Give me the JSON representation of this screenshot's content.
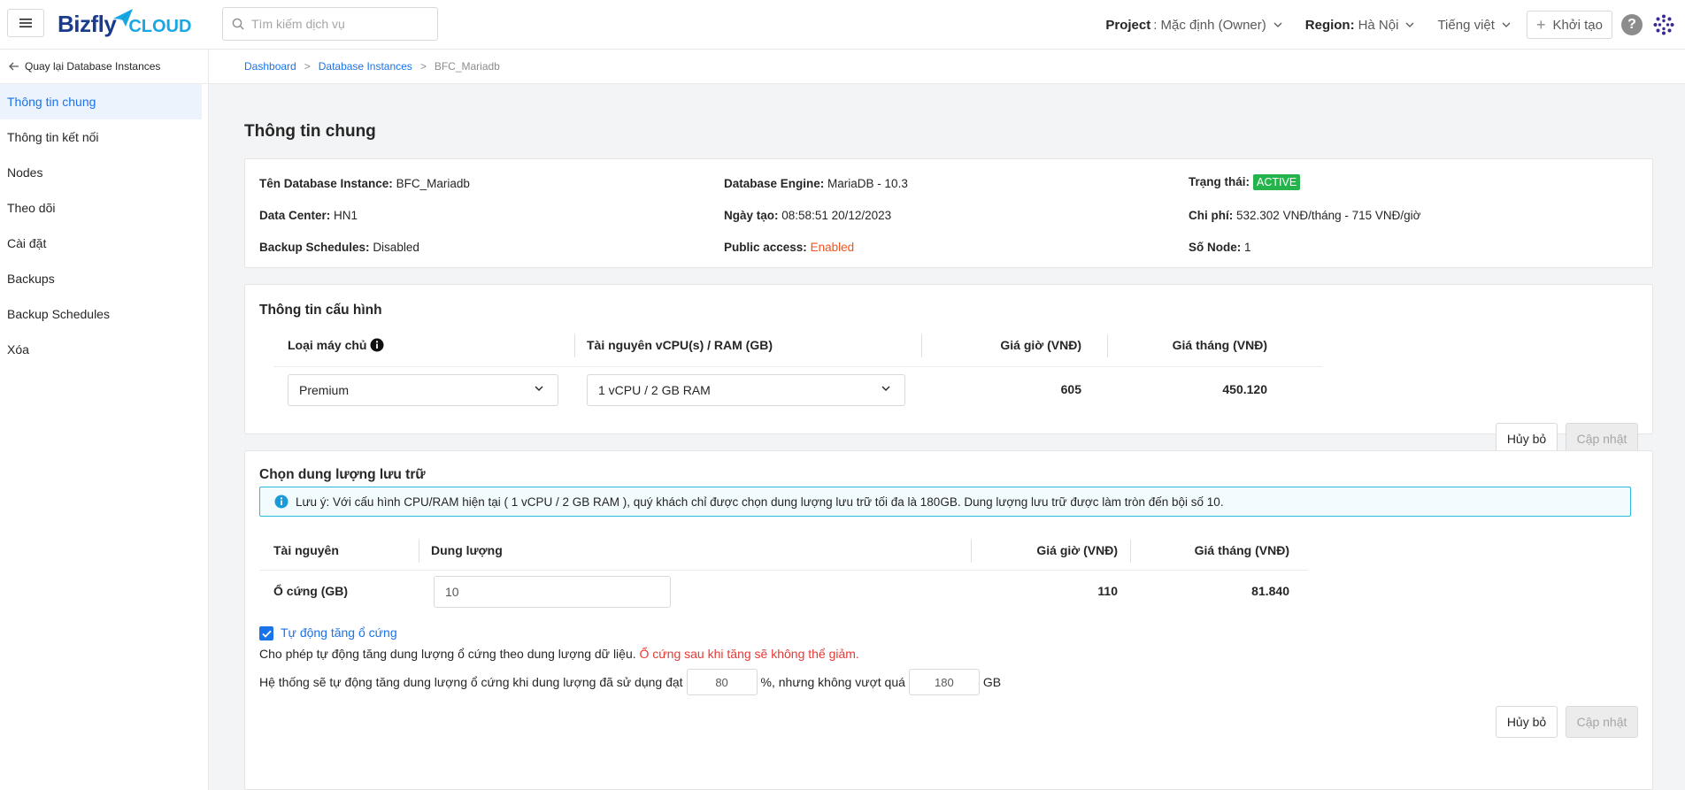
{
  "header": {
    "logo_main": "Bizfly",
    "logo_sub": "CLOUD",
    "search_placeholder": "Tìm kiếm dịch vụ",
    "project_label": "Project",
    "project_value": ": Mặc định (Owner)",
    "region_label": "Region:",
    "region_value": "Hà Nội",
    "language": "Tiếng việt",
    "create_label": "Khởi tạo",
    "help_glyph": "?"
  },
  "sidebar": {
    "back_label": "Quay lại Database Instances",
    "items": [
      {
        "label": "Thông tin chung",
        "active": true
      },
      {
        "label": "Thông tin kết nối"
      },
      {
        "label": "Nodes"
      },
      {
        "label": "Theo dõi"
      },
      {
        "label": "Cài đặt"
      },
      {
        "label": "Backups"
      },
      {
        "label": "Backup Schedules"
      },
      {
        "label": "Xóa"
      }
    ]
  },
  "breadcrumb": {
    "items": [
      "Dashboard",
      "Database Instances",
      "BFC_Mariadb"
    ],
    "separator": ">"
  },
  "page_title": "Thông tin chung",
  "general": {
    "instance_name_label": "Tên Database Instance:",
    "instance_name": "BFC_Mariadb",
    "datacenter_label": "Data Center:",
    "datacenter": "HN1",
    "backup_label": "Backup Schedules:",
    "backup": "Disabled",
    "engine_label": "Database Engine:",
    "engine": "MariaDB - 10.3",
    "created_label": "Ngày tạo:",
    "created": "08:58:51 20/12/2023",
    "public_label": "Public access:",
    "public": "Enabled",
    "status_label": "Trạng thái:",
    "status": "ACTIVE",
    "cost_label": "Chi phí:",
    "cost": "532.302 VNĐ/tháng - 715 VNĐ/giờ",
    "nodes_label": "Số Node:",
    "nodes": "1"
  },
  "config": {
    "title": "Thông tin cấu hình",
    "col_type": "Loại máy chủ",
    "col_resource": "Tài nguyên vCPU(s) / RAM (GB)",
    "col_hour": "Giá giờ (VNĐ)",
    "col_month": "Giá tháng (VNĐ)",
    "type_value": "Premium",
    "resource_value": "1 vCPU / 2 GB RAM",
    "hour_price": "605",
    "month_price": "450.120",
    "cancel_label": "Hủy bỏ",
    "update_label": "Cập nhật"
  },
  "storage": {
    "title": "Chọn dung lượng lưu trữ",
    "notice": "Lưu ý: Với cấu hình CPU/RAM hiện tại ( 1 vCPU / 2 GB RAM ), quý khách chỉ được chọn dung lượng lưu trữ tối đa là 180GB. Dung lượng lưu trữ được làm tròn đến bội số 10.",
    "col_resource": "Tài nguyên",
    "col_capacity": "Dung lượng",
    "col_hour": "Giá giờ (VNĐ)",
    "col_month": "Giá tháng (VNĐ)",
    "row_label": "Ổ cứng (GB)",
    "capacity_value": "10",
    "hour_price": "110",
    "month_price": "81.840",
    "auto_label": "Tự động tăng ổ cứng",
    "auto_checked": true,
    "auto_desc": "Cho phép tự động tăng dung lượng ổ cứng theo dung lượng dữ liệu.",
    "auto_warn": "Ổ cứng sau khi tăng sẽ không thể giảm.",
    "threshold_pre": "Hệ thống sẽ tự động tăng dung lượng ổ cứng khi dung lượng đã sử dụng đạt",
    "threshold_value": "80",
    "threshold_mid": "%, nhưng không vượt quá",
    "max_value": "180",
    "threshold_unit": "GB",
    "cancel_label": "Hủy bỏ",
    "update_label": "Cập nhật"
  },
  "colors": {
    "accent": "#1a73e8",
    "active_badge": "#25b34b",
    "warning": "#f4511e",
    "notice_border": "#2bb9d8"
  }
}
